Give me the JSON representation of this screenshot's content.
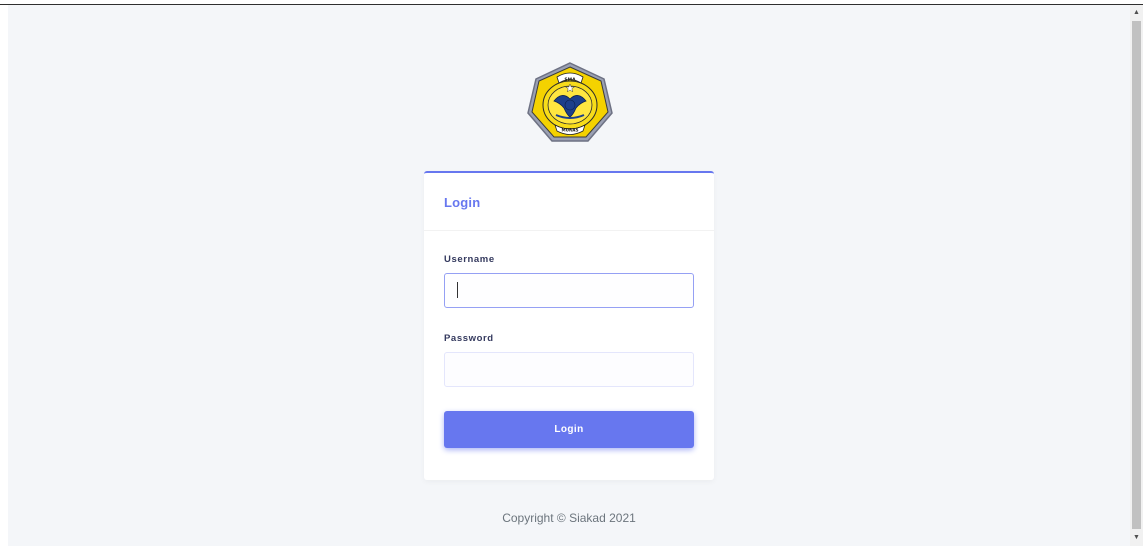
{
  "logo": {
    "name": "school-emblem",
    "top_text": "SMA",
    "bottom_text": "MURAS"
  },
  "login_card": {
    "title": "Login",
    "username": {
      "label": "Username",
      "value": "",
      "placeholder": ""
    },
    "password": {
      "label": "Password",
      "value": "",
      "placeholder": ""
    },
    "submit_label": "Login"
  },
  "footer": {
    "text": "Copyright © Siakad 2021"
  },
  "colors": {
    "accent": "#6777ef",
    "page_background": "#f4f6f9",
    "card_background": "#ffffff"
  },
  "scrollbar": {
    "up_icon": "triangle-up",
    "down_icon": "triangle-down"
  }
}
